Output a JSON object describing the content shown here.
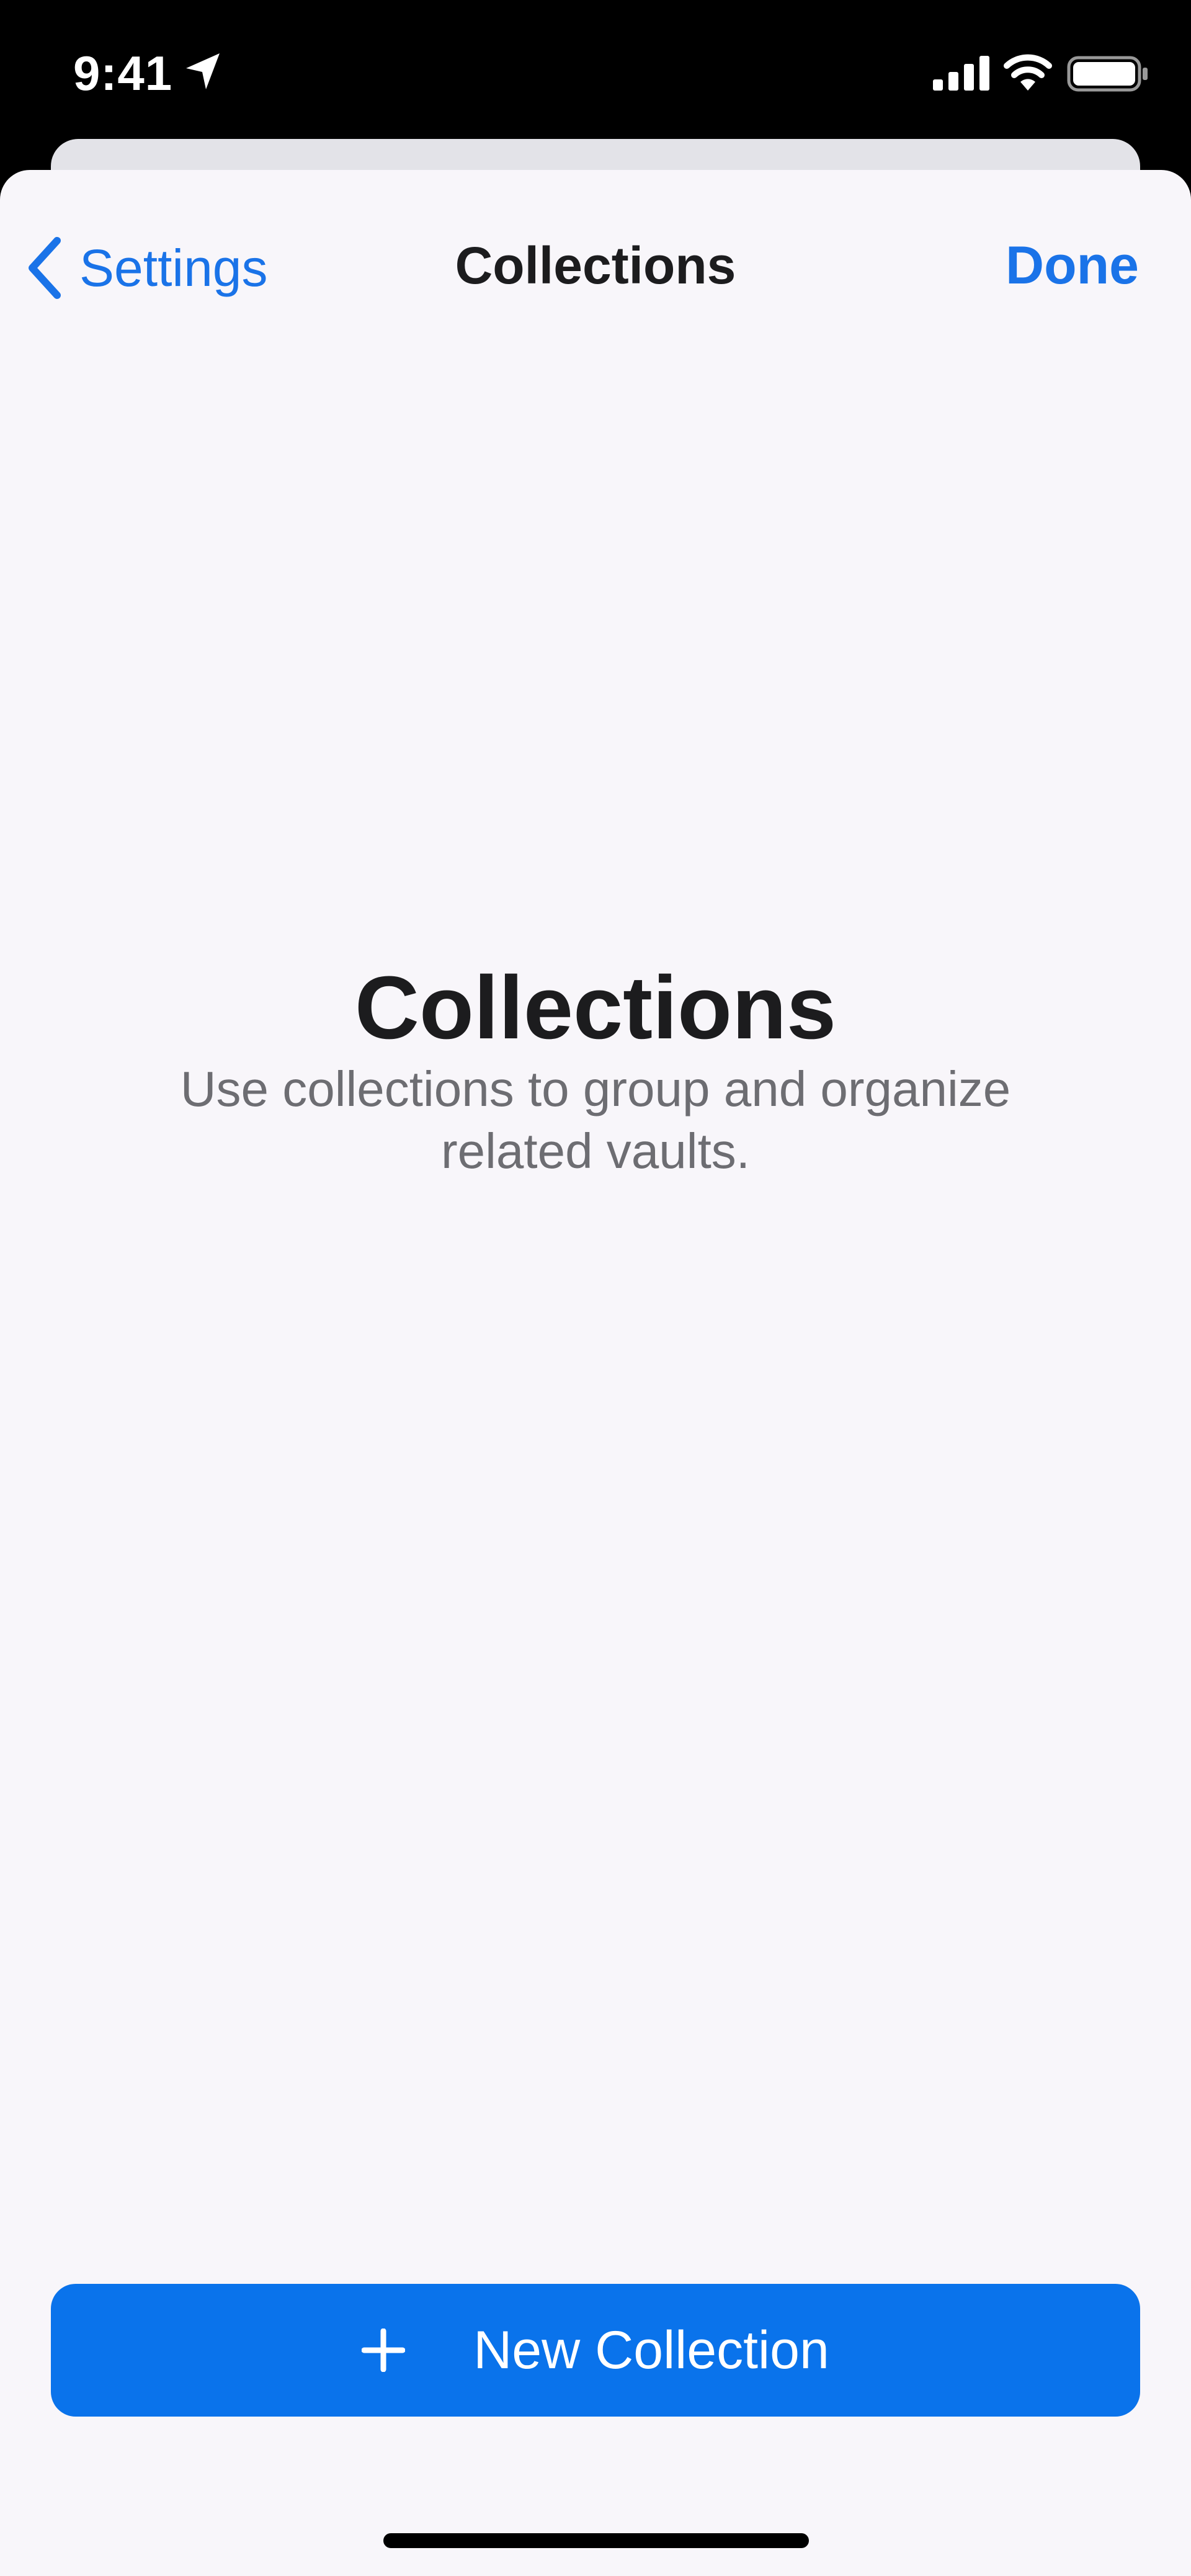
{
  "status_bar": {
    "time": "9:41",
    "icons": [
      "location-arrow-icon",
      "cellular-signal-icon",
      "wifi-icon",
      "battery-icon"
    ]
  },
  "nav": {
    "back_label": "Settings",
    "title": "Collections",
    "done_label": "Done"
  },
  "empty_state": {
    "title": "Collections",
    "description": "Use collections to group and organize related vaults."
  },
  "actions": {
    "new_collection_label": "New Collection",
    "new_collection_icon": "plus-icon"
  },
  "colors": {
    "accent": "#1a73e8",
    "button_bg": "#0a73eb",
    "sheet_bg": "#f8f6fa",
    "title_text": "#1c1c1e",
    "secondary_text": "#6d6d72"
  }
}
